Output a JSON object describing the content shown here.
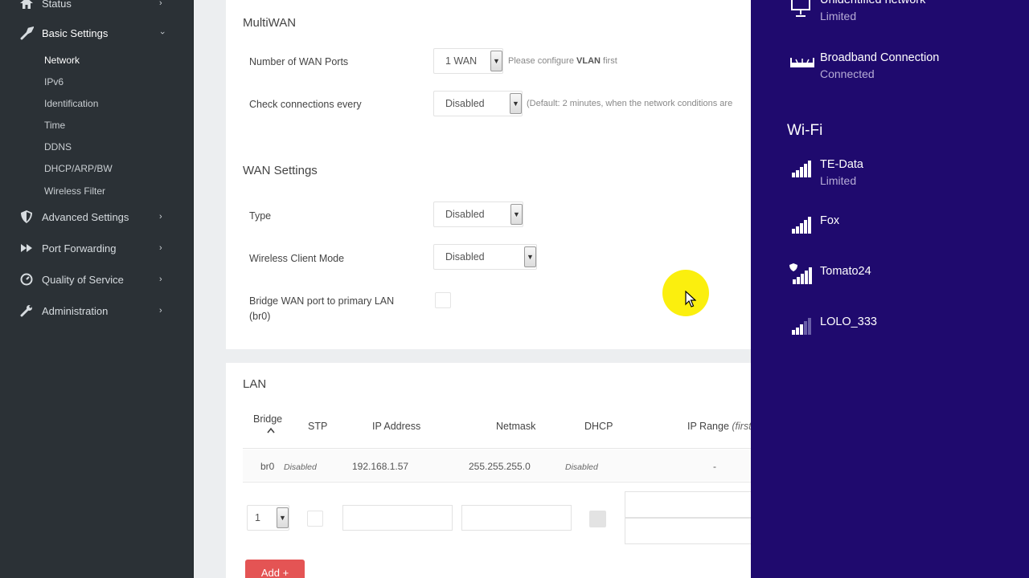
{
  "sidebar": {
    "items": [
      {
        "label": "Status",
        "icon": "home-icon"
      },
      {
        "label": "Basic Settings",
        "icon": "wrench-icon",
        "expanded": true
      },
      {
        "label": "Advanced Settings",
        "icon": "shield-icon"
      },
      {
        "label": "Port Forwarding",
        "icon": "forward-icon"
      },
      {
        "label": "Quality of Service",
        "icon": "gauge-icon"
      },
      {
        "label": "Administration",
        "icon": "tools-icon"
      }
    ],
    "sub_items": [
      "Network",
      "IPv6",
      "Identification",
      "Time",
      "DDNS",
      "DHCP/ARP/BW",
      "Wireless Filter"
    ]
  },
  "multiwan": {
    "title": "MultiWAN",
    "wan_ports_label": "Number of WAN Ports",
    "wan_ports_value": "1 WAN",
    "wan_ports_hint_pre": "Please configure",
    "wan_ports_hint_bold": "VLAN",
    "wan_ports_hint_post": "first",
    "check_label": "Check connections every",
    "check_value": "Disabled",
    "check_hint": "(Default: 2 minutes, when the network conditions are"
  },
  "wan": {
    "title": "WAN Settings",
    "type_label": "Type",
    "type_value": "Disabled",
    "client_label": "Wireless Client Mode",
    "client_value": "Disabled",
    "bridge_label_1": "Bridge WAN port to primary LAN",
    "bridge_label_2": "(br0)"
  },
  "lan": {
    "title": "LAN",
    "headers": [
      "Bridge",
      "STP",
      "IP Address",
      "Netmask",
      "DHCP",
      "IP Range"
    ],
    "range_suffix": "(first",
    "row": {
      "bridge": "br0",
      "stp": "Disabled",
      "ip": "192.168.1.57",
      "netmask": "255.255.255.0",
      "dhcp": "Disabled",
      "range": "-"
    },
    "new_bridge_value": "1",
    "add_label": "Add +"
  },
  "flyout": {
    "networks": [
      {
        "name": "Unidentified network",
        "status": "Limited"
      },
      {
        "name": "Broadband Connection",
        "status": "Connected"
      }
    ],
    "wifi_heading": "Wi-Fi",
    "wifi": [
      {
        "name": "TE-Data",
        "status": "Limited"
      },
      {
        "name": "Fox",
        "status": ""
      },
      {
        "name": "Tomato24",
        "status": ""
      },
      {
        "name": "LOLO_333",
        "status": ""
      }
    ]
  },
  "colors": {
    "sidebar_bg": "#2b3136",
    "flyout_bg": "#1f0a6e",
    "add_button": "#e45454",
    "cursor_highlight": "#fbef0e"
  }
}
